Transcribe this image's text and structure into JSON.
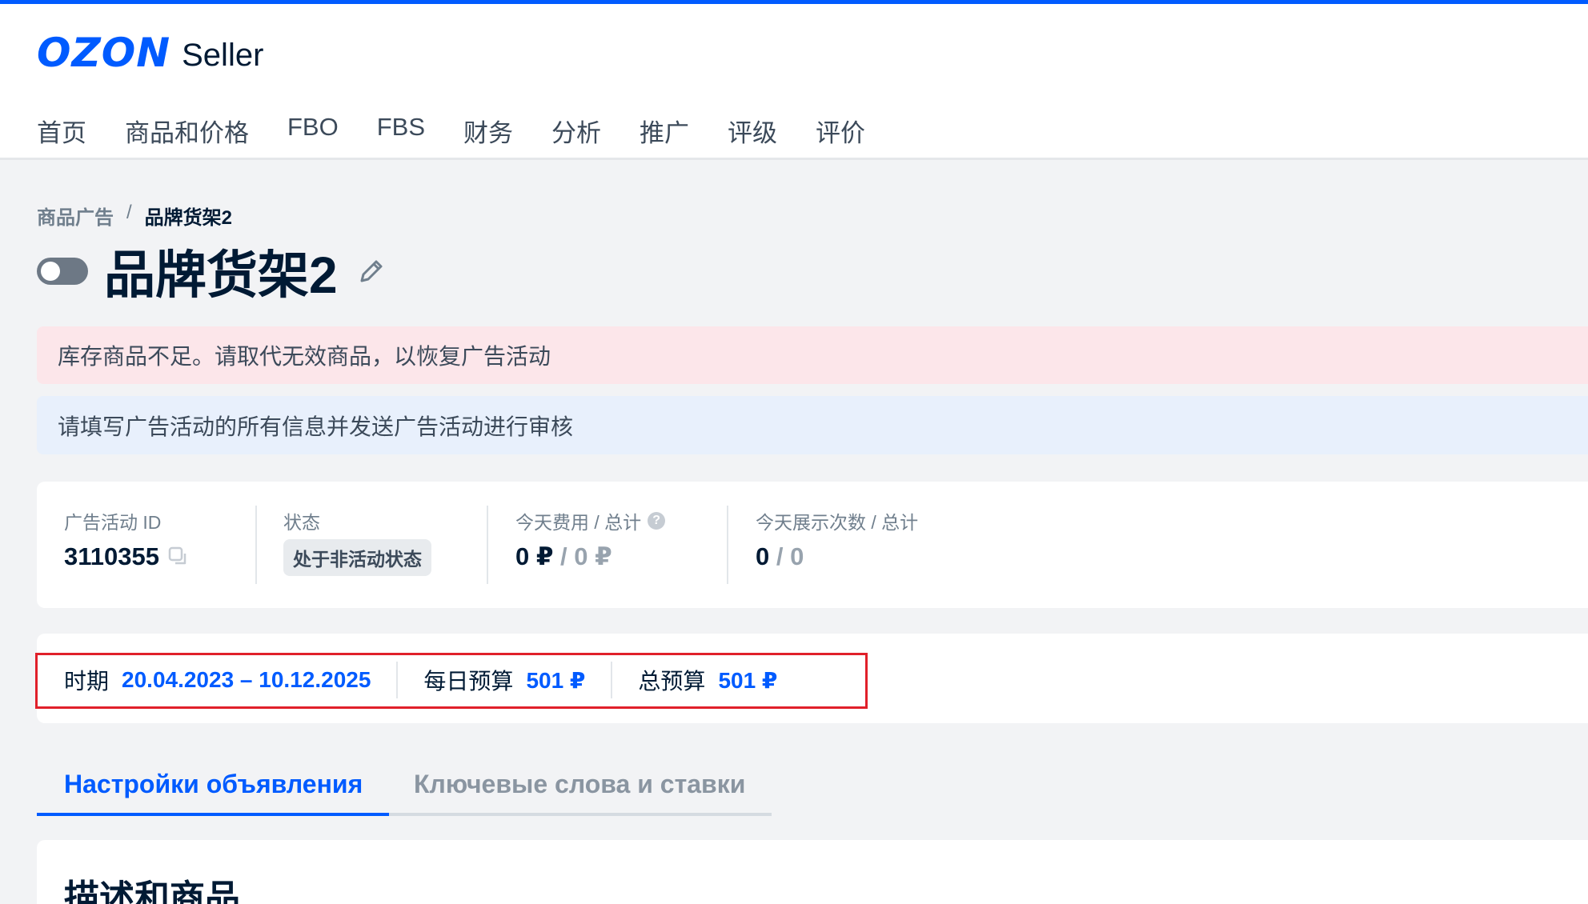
{
  "header": {
    "logo_brand": "OZON",
    "logo_product": "Seller",
    "nav": [
      "首页",
      "商品和价格",
      "FBO",
      "FBS",
      "财务",
      "分析",
      "推广",
      "评级",
      "评价"
    ]
  },
  "breadcrumb": {
    "parent": "商品广告",
    "separator": "/",
    "current": "品牌货架2"
  },
  "page": {
    "title": "品牌货架2"
  },
  "alerts": {
    "error": "库存商品不足。请取代无效商品，以恢复广告活动",
    "info": "请填写广告活动的所有信息并发送广告活动进行审核"
  },
  "stats": {
    "campaign_id_label": "广告活动 ID",
    "campaign_id": "3110355",
    "status_label": "状态",
    "status_value": "处于非活动状态",
    "cost_label": "今天费用 / 总计",
    "cost_today": "0 ₽",
    "cost_sep": " / ",
    "cost_total": "0 ₽",
    "impressions_label": "今天展示次数 / 总计",
    "impressions_today": "0",
    "impressions_sep": " / ",
    "impressions_total": "0"
  },
  "period": {
    "period_label": "时期",
    "period_value": "20.04.2023 – 10.12.2025",
    "daily_budget_label": "每日预算",
    "daily_budget_value": "501 ₽",
    "total_budget_label": "总预算",
    "total_budget_value": "501 ₽",
    "highlight_color": "#e0202a"
  },
  "tabs": {
    "active": "Настройки объявления",
    "inactive": "Ключевые слова и ставки"
  },
  "section": {
    "title": "描述和商品"
  },
  "colors": {
    "brand": "#005bff",
    "text": "#001a34",
    "error_bg": "#fce6ea",
    "info_bg": "#e8f0fc"
  }
}
